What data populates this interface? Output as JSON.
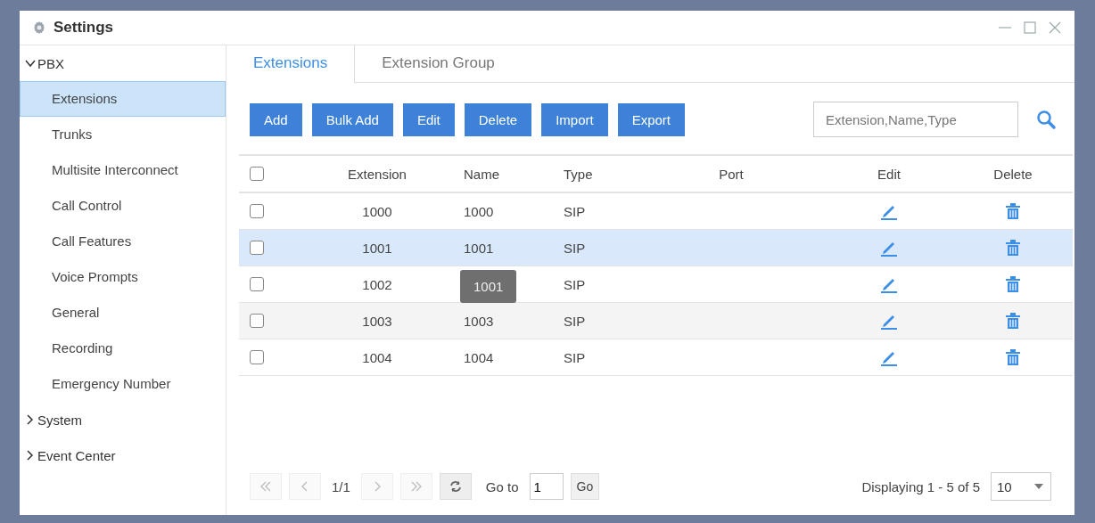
{
  "window": {
    "title": "Settings"
  },
  "sidebar": {
    "items": [
      {
        "label": "PBX",
        "expanded": true,
        "children": [
          {
            "label": "Extensions",
            "selected": true
          },
          {
            "label": "Trunks",
            "selected": false
          },
          {
            "label": "Multisite Interconnect",
            "selected": false
          },
          {
            "label": "Call Control",
            "selected": false
          },
          {
            "label": "Call Features",
            "selected": false
          },
          {
            "label": "Voice Prompts",
            "selected": false
          },
          {
            "label": "General",
            "selected": false
          },
          {
            "label": "Recording",
            "selected": false
          },
          {
            "label": "Emergency Number",
            "selected": false
          }
        ]
      },
      {
        "label": "System",
        "expanded": false
      },
      {
        "label": "Event Center",
        "expanded": false
      }
    ]
  },
  "tabs": [
    {
      "label": "Extensions",
      "selected": true
    },
    {
      "label": "Extension Group",
      "selected": false
    }
  ],
  "toolbar": {
    "buttons": [
      "Add",
      "Bulk Add",
      "Edit",
      "Delete",
      "Import",
      "Export"
    ],
    "search": {
      "placeholder": "Extension,Name,Type"
    }
  },
  "table": {
    "select_all_checked": false,
    "columns": [
      "Extension",
      "Name",
      "Type",
      "Port",
      "Edit",
      "Delete"
    ],
    "rows": [
      {
        "extension": "1000",
        "name": "1000",
        "type": "SIP",
        "checked": false,
        "selected": false
      },
      {
        "extension": "1001",
        "name": "1001",
        "type": "SIP",
        "checked": false,
        "selected": true
      },
      {
        "extension": "1002",
        "type": "SIP",
        "checked": false,
        "selected": false,
        "tooltip": "1001"
      },
      {
        "extension": "1003",
        "name": "1003",
        "type": "SIP",
        "checked": false,
        "selected": false
      },
      {
        "extension": "1004",
        "name": "1004",
        "type": "SIP",
        "checked": false,
        "selected": false
      }
    ]
  },
  "pagination": {
    "page": "1/1",
    "goto_label": "Go to",
    "goto_value": "1",
    "go_button": "Go",
    "summary": "Displaying 1 - 5 of 5",
    "page_size": "10"
  }
}
